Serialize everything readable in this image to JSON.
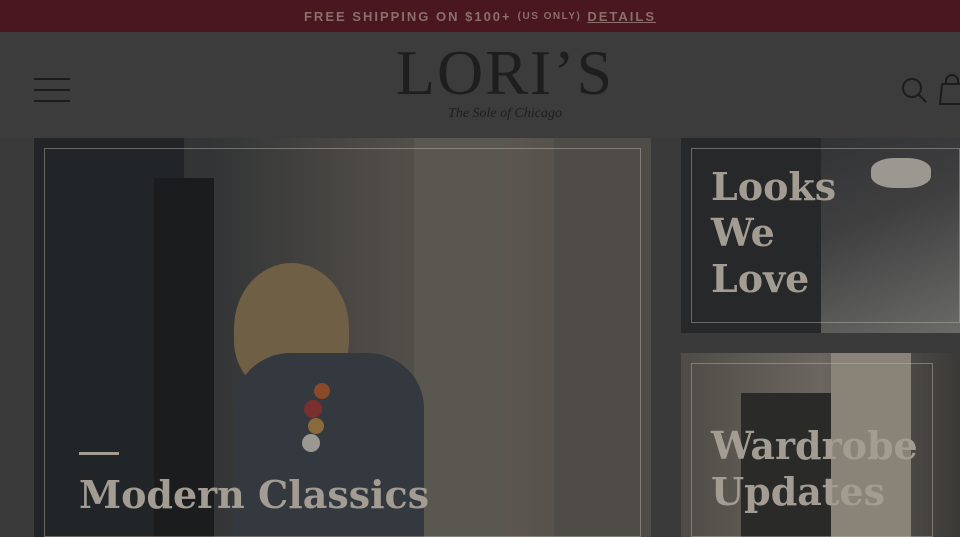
{
  "promo": {
    "main": "FREE SHIPPING ON $100+",
    "note": "(US ONLY)",
    "details_link": "DETAILS"
  },
  "header": {
    "menu_icon": "hamburger-menu-icon",
    "logo_text": "LORI’S",
    "logo_tagline": "The Sole of Chicago",
    "search_icon": "search-icon",
    "cart_icon": "shopping-bag-icon"
  },
  "cards": {
    "main_title": "Modern Classics",
    "looks_title_line1": "Looks",
    "looks_title_line2": "We",
    "looks_title_line3": "Love",
    "wardrobe_title_line1": "Wardrobe",
    "wardrobe_title_line2": "Updates"
  },
  "colors": {
    "promo_bg": "#4a1620",
    "overlay": "#3a3a3a",
    "title": "#a39c92"
  }
}
